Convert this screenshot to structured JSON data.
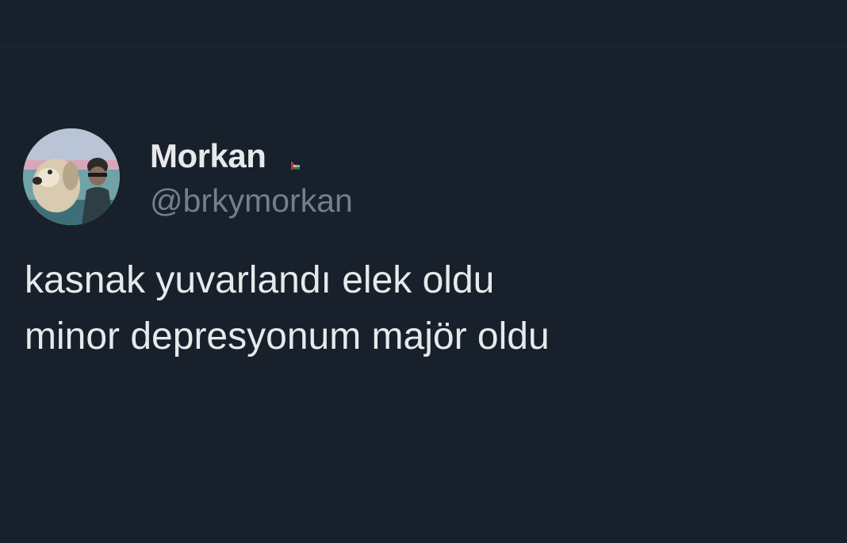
{
  "tweet": {
    "author": {
      "display_name": "Morkan",
      "handle": "@brkymorkan",
      "avatar_icon": "avatar-photo-dog-and-man",
      "badge_icon": "flag-icon"
    },
    "text_lines": [
      "kasnak yuvarlandı elek oldu",
      "minor depresyonum majör oldu"
    ]
  },
  "colors": {
    "background": "#17202b",
    "text_primary": "#e7e9ea",
    "text_secondary": "#71808d"
  }
}
